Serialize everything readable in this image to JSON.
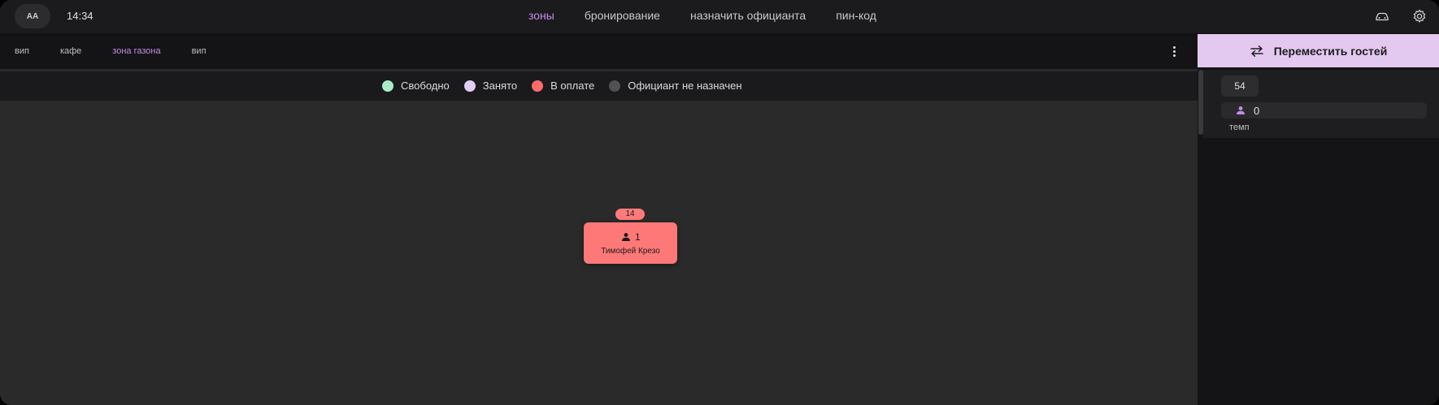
{
  "header": {
    "avatar_initials": "AA",
    "time": "14:34",
    "nav": [
      {
        "label": "зоны",
        "active": true
      },
      {
        "label": "бронирование",
        "active": false
      },
      {
        "label": "назначить официанта",
        "active": false
      },
      {
        "label": "пин-код",
        "active": false
      }
    ],
    "icons": [
      "car-icon",
      "gear-icon"
    ]
  },
  "zones": {
    "tabs": [
      {
        "label": "вип",
        "active": false
      },
      {
        "label": "кафе",
        "active": false
      },
      {
        "label": "зона газона",
        "active": true
      },
      {
        "label": "вип",
        "active": false
      }
    ],
    "menu_icon": "more-vertical-icon"
  },
  "legend": [
    {
      "label": "Свободно",
      "color": "#a8ecc9"
    },
    {
      "label": "Занято",
      "color": "#e2cef5"
    },
    {
      "label": "В оплате",
      "color": "#ff6b6b"
    },
    {
      "label": "Официант не назначен",
      "color": "#505055"
    }
  ],
  "table": {
    "number": "14",
    "guests": "1",
    "waiter": "Тимофей Крезо",
    "status_color": "#ff7878"
  },
  "right_panel": {
    "move_button_label": "Переместить гостей",
    "move_icon": "swap-arrows-icon",
    "table_number": "54",
    "guest_count": "0",
    "guest_icon": "person-icon",
    "waiter_name": "темп"
  }
}
